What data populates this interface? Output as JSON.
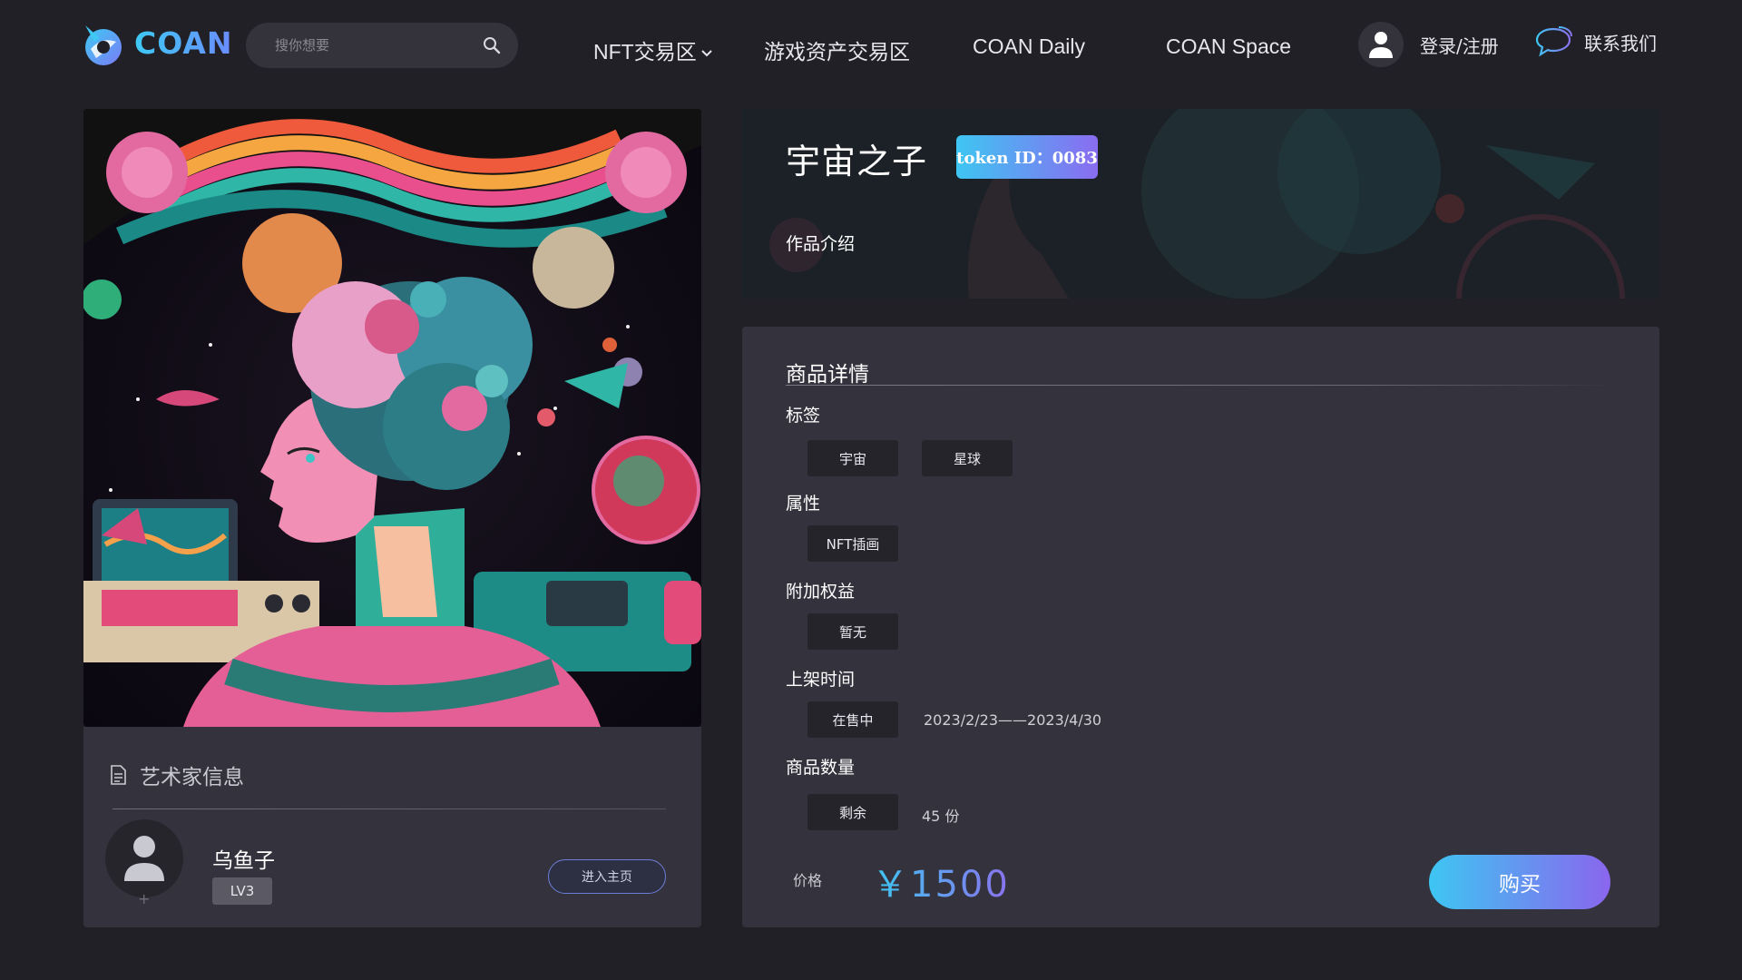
{
  "header": {
    "logo_text": "COAN",
    "search_placeholder": "搜你想要",
    "nav": [
      {
        "label": "NFT交易区",
        "has_dropdown": true
      },
      {
        "label": "游戏资产交易区"
      },
      {
        "label": "COAN Daily"
      },
      {
        "label": "COAN Space"
      }
    ],
    "login_label": "登录/注册",
    "contact_label": "联系我们"
  },
  "artist": {
    "section_title": "艺术家信息",
    "name": "乌鱼子",
    "level": "LV3",
    "home_button": "进入主页"
  },
  "artwork": {
    "title": "宇宙之子",
    "token_badge": "token ID：0083",
    "intro_label": "作品介绍"
  },
  "details": {
    "section_title": "商品详情",
    "tags_label": "标签",
    "tags": [
      "宇宙",
      "星球"
    ],
    "attributes_label": "属性",
    "attributes": [
      "NFT插画"
    ],
    "benefits_label": "附加权益",
    "benefits": [
      "暂无"
    ],
    "listing_label": "上架时间",
    "listing_status": "在售中",
    "listing_period": "2023/2/23——2023/4/30",
    "quantity_label": "商品数量",
    "quantity_chip": "剩余",
    "quantity_value": "45 份",
    "price_label": "价格",
    "price_value": "￥1500",
    "buy_button": "购买"
  },
  "colors": {
    "background": "#212027",
    "panel": "#34333d",
    "chip": "#25242b",
    "accent_start": "#3ec6f2",
    "accent_end": "#8a66ee"
  }
}
